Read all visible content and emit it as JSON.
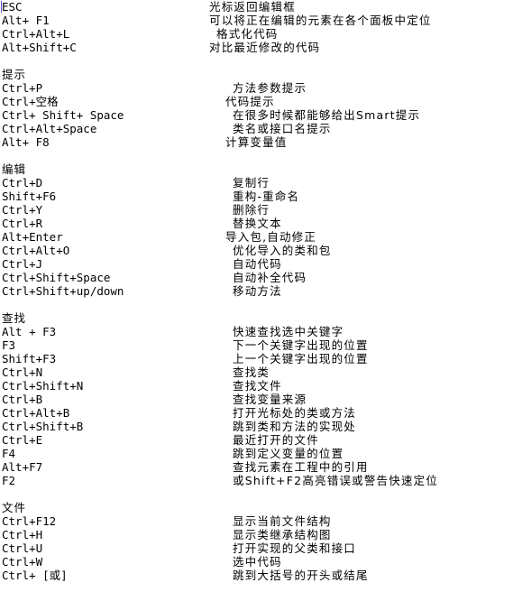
{
  "s0": {
    "r0": {
      "key": "ESC",
      "desc": "光标返回编辑框"
    },
    "r1": {
      "key": "Alt+ F1",
      "desc": "可以将正在编辑的元素在各个面板中定位"
    },
    "r2": {
      "key": "Ctrl+Alt+L",
      "desc": "格式化代码"
    },
    "r3": {
      "key": "Alt+Shift+C",
      "desc": "对比最近修改的代码"
    }
  },
  "s1": {
    "title": "提示",
    "r0": {
      "key": "Ctrl+P",
      "desc": "方法参数提示"
    },
    "r1": {
      "key": "Ctrl+空格",
      "desc": "代码提示"
    },
    "r2": {
      "key": "Ctrl+ Shift+ Space",
      "desc": "在很多时候都能够给出Smart提示"
    },
    "r3": {
      "key": "Ctrl+Alt+Space",
      "desc": "类名或接口名提示"
    },
    "r4": {
      "key": "Alt+ F8",
      "desc": "计算变量值"
    }
  },
  "s2": {
    "title": "编辑",
    "r0": {
      "key": "Ctrl+D",
      "desc": "复制行"
    },
    "r1": {
      "key": "Shift+F6",
      "desc": "重构-重命名"
    },
    "r2": {
      "key": "Ctrl+Y",
      "desc": "删除行"
    },
    "r3": {
      "key": "Ctrl+R",
      "desc": "替换文本"
    },
    "r4": {
      "key": "Alt+Enter",
      "desc": "导入包,自动修正"
    },
    "r5": {
      "key": "Ctrl+Alt+O",
      "desc": "优化导入的类和包"
    },
    "r6": {
      "key": "Ctrl+J",
      "desc": "自动代码"
    },
    "r7": {
      "key": "Ctrl+Shift+Space",
      "desc": "自动补全代码"
    },
    "r8": {
      "key": "Ctrl+Shift+up/down",
      "desc": "移动方法"
    }
  },
  "s3": {
    "title": "查找",
    "r0": {
      "key": "Alt + F3",
      "desc": "快速查找选中关键字"
    },
    "r1": {
      "key": "F3",
      "desc": "下一个关键字出现的位置"
    },
    "r2": {
      "key": "Shift+F3",
      "desc": "上一个关键字出现的位置"
    },
    "r3": {
      "key": "Ctrl+N",
      "desc": "查找类"
    },
    "r4": {
      "key": "Ctrl+Shift+N",
      "desc": "查找文件"
    },
    "r5": {
      "key": "Ctrl+B",
      "desc": "查找变量来源"
    },
    "r6": {
      "key": "Ctrl+Alt+B",
      "desc": "打开光标处的类或方法"
    },
    "r7": {
      "key": "Ctrl+Shift+B",
      "desc": "跳到类和方法的实现处"
    },
    "r8": {
      "key": "Ctrl+E",
      "desc": "最近打开的文件"
    },
    "r9": {
      "key": "F4",
      "desc": "跳到定义变量的位置"
    },
    "r10": {
      "key": "Alt+F7",
      "desc": "查找元素在工程中的引用"
    },
    "r11": {
      "key": "F2",
      "desc": "或Shift+F2高亮错误或警告快速定位"
    }
  },
  "s4": {
    "title": "文件",
    "r0": {
      "key": "Ctrl+F12",
      "desc": "显示当前文件结构"
    },
    "r1": {
      "key": "Ctrl+H",
      "desc": "显示类继承结构图"
    },
    "r2": {
      "key": "Ctrl+U",
      "desc": "打开实现的父类和接口"
    },
    "r3": {
      "key": "Ctrl+W",
      "desc": "选中代码"
    },
    "r4": {
      "key": "Ctrl+ [或]",
      "desc": "跳到大括号的开头或结尾"
    }
  }
}
